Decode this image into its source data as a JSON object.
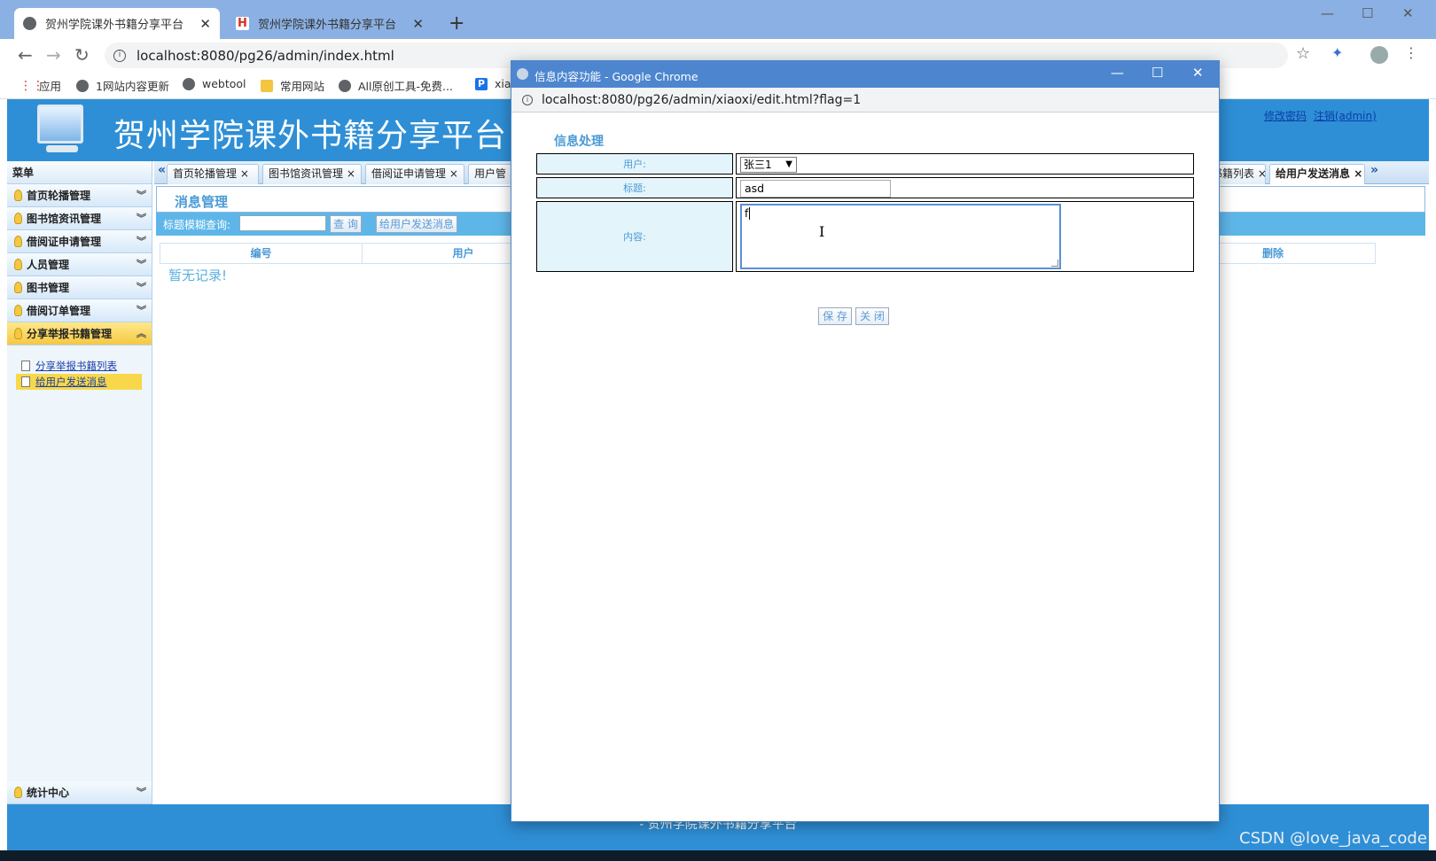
{
  "browser": {
    "tabs": [
      {
        "label": "贺州学院课外书籍分享平台",
        "active": true
      },
      {
        "label": "贺州学院课外书籍分享平台",
        "active": false
      }
    ],
    "url": "localhost:8080/pg26/admin/index.html",
    "bookmarks": [
      "应用",
      "1网站内容更新",
      "webtool",
      "常用网站",
      "All原创工具-免费...",
      "xia"
    ]
  },
  "header": {
    "title": "贺州学院课外书籍分享平台",
    "link_change_password": "修改密码",
    "link_logout": "注销(admin)"
  },
  "sidebar": {
    "heading": "菜单",
    "items": [
      {
        "label": "首页轮播管理"
      },
      {
        "label": "图书馆资讯管理"
      },
      {
        "label": "借阅证申请管理"
      },
      {
        "label": "人员管理"
      },
      {
        "label": "图书管理"
      },
      {
        "label": "借阅订单管理"
      },
      {
        "label": "分享举报书籍管理"
      }
    ],
    "submenu": [
      {
        "label": "分享举报书籍列表"
      },
      {
        "label": "给用户发送消息"
      }
    ],
    "bottom_item": "统计中心"
  },
  "content": {
    "tabs": [
      {
        "label": "首页轮播管理"
      },
      {
        "label": "图书馆资讯管理"
      },
      {
        "label": "借阅证申请管理"
      },
      {
        "label": "用户管"
      },
      {
        "label": "举报书籍列表"
      },
      {
        "label": "给用户发送消息"
      }
    ],
    "panel_title": "消息管理",
    "search_label": "标题模糊查询:",
    "search_button": "查 询",
    "send_button": "给用户发送消息",
    "columns": [
      "编号",
      "用户",
      "删除"
    ],
    "empty_text": "暂无记录!"
  },
  "footer": {
    "text": "- 贺州学院课外书籍分享平台"
  },
  "popup": {
    "window_title": "信息内容功能 - Google Chrome",
    "url": "localhost:8080/pg26/admin/xiaoxi/edit.html?flag=1",
    "form_title": "信息处理",
    "label_user": "用户:",
    "user_value": "张三1",
    "label_title": "标题:",
    "title_value": "asd",
    "label_content": "内容:",
    "content_value": "f",
    "save_button": "保 存",
    "close_button": "关 闭"
  },
  "watermark": "CSDN @love_java_code"
}
